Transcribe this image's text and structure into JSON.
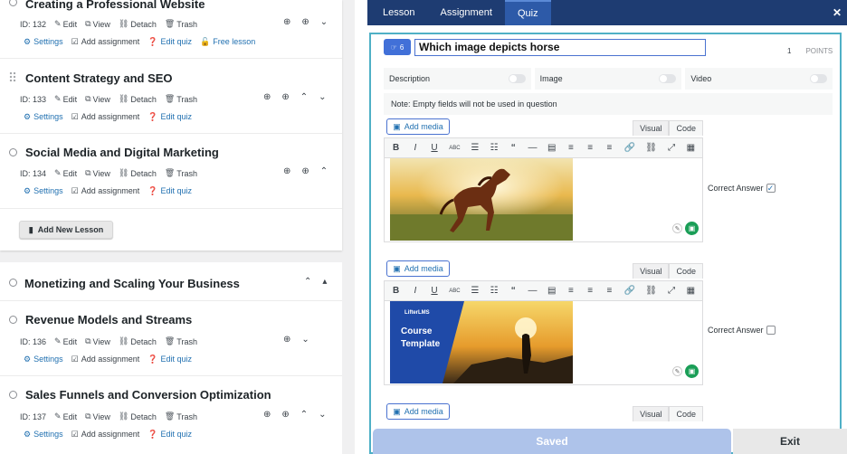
{
  "lessons": [
    {
      "title": "Creating a Professional Website",
      "id": "ID: 132",
      "edit": "Edit",
      "view": "View",
      "detach": "Detach",
      "trash": "Trash",
      "settings": "Settings",
      "add_assignment": "Add assignment",
      "edit_quiz": "Edit quiz",
      "free_lesson": "Free lesson"
    },
    {
      "title": "Content Strategy and SEO",
      "id": "ID: 133",
      "edit": "Edit",
      "view": "View",
      "detach": "Detach",
      "trash": "Trash",
      "settings": "Settings",
      "add_assignment": "Add assignment",
      "edit_quiz": "Edit quiz"
    },
    {
      "title": "Social Media and Digital Marketing",
      "id": "ID: 134",
      "edit": "Edit",
      "view": "View",
      "detach": "Detach",
      "trash": "Trash",
      "settings": "Settings",
      "add_assignment": "Add assignment",
      "edit_quiz": "Edit quiz"
    },
    {
      "title": "Revenue Models and Streams",
      "id": "ID: 136",
      "edit": "Edit",
      "view": "View",
      "detach": "Detach",
      "trash": "Trash",
      "settings": "Settings",
      "add_assignment": "Add assignment",
      "edit_quiz": "Edit quiz"
    },
    {
      "title": "Sales Funnels and Conversion Optimization",
      "id": "ID: 137",
      "edit": "Edit",
      "view": "View",
      "detach": "Detach",
      "trash": "Trash",
      "settings": "Settings",
      "add_assignment": "Add assignment",
      "edit_quiz": "Edit quiz"
    }
  ],
  "add_new_lesson": "Add New Lesson",
  "section2_title": "Monetizing and Scaling Your Business",
  "modal": {
    "tabs": [
      "Lesson",
      "Assignment",
      "Quiz"
    ],
    "active_tab": "Quiz",
    "question_number": "6",
    "question_title": "Which image depicts horse",
    "points_value": "1",
    "points_label": "POINTS",
    "toggles": [
      "Description",
      "Image",
      "Video"
    ],
    "note": "Note: Empty fields will not be used in question",
    "add_media": "Add media",
    "visual": "Visual",
    "code": "Code",
    "correct_answer": "Correct Answer",
    "answers": [
      {
        "correct": true
      },
      {
        "correct": false
      }
    ],
    "template_brand": "LifterLMS",
    "template_text": "Course Template",
    "saved": "Saved",
    "exit": "Exit"
  }
}
